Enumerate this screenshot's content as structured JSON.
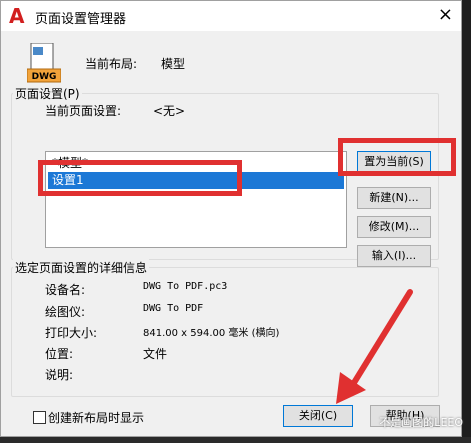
{
  "window": {
    "title": "页面设置管理器",
    "close_glyph": "×"
  },
  "header": {
    "current_layout_label": "当前布局:",
    "current_layout_value": "模型",
    "file_icon_text": "DWG"
  },
  "page_setup": {
    "group_title": "页面设置(P)",
    "current_setup_label": "当前页面设置:",
    "current_setup_value": "<无>",
    "items": [
      "*模型*",
      "设置1"
    ],
    "selected_index": 1
  },
  "buttons": {
    "set_current": "置为当前(S)",
    "new": "新建(N)...",
    "modify": "修改(M)...",
    "import": "输入(I)...",
    "close": "关闭(C)",
    "help": "帮助(H)"
  },
  "details": {
    "group_title": "选定页面设置的详细信息",
    "rows": [
      {
        "label": "设备名:",
        "value": "DWG To PDF.pc3"
      },
      {
        "label": "绘图仪:",
        "value": "DWG To PDF"
      },
      {
        "label": "打印大小:",
        "value": "841.00 x 594.00 毫米 (横向)"
      },
      {
        "label": "位置:",
        "value": "文件"
      },
      {
        "label": "说明:",
        "value": ""
      }
    ]
  },
  "footer": {
    "show_on_new_layout": "创建新布局时显示",
    "checked": false
  },
  "watermark": "不是画图的LEEO",
  "colors": {
    "highlight": "#e03030",
    "selection": "#1c78d6",
    "app_icon": "#d21f1f"
  }
}
